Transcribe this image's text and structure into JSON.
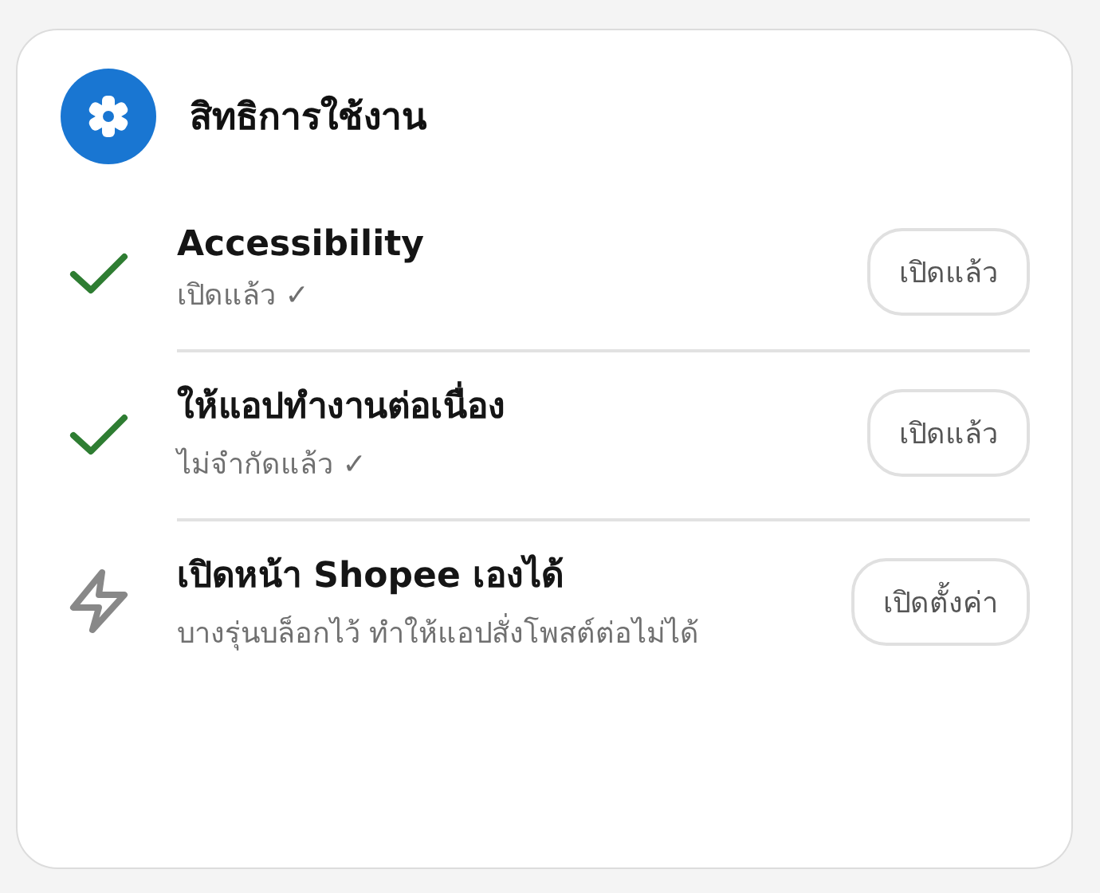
{
  "header": {
    "title": "สิทธิการใช้งาน"
  },
  "permissions": [
    {
      "kind": "done",
      "title": "Accessibility",
      "description": "เปิดแล้ว ✓",
      "button": "เปิดแล้ว"
    },
    {
      "kind": "done",
      "title": "ให้แอปทำงานต่อเนื่อง",
      "description": "ไม่จำกัดแล้ว ✓",
      "button": "เปิดแล้ว"
    },
    {
      "kind": "action",
      "title": "เปิดหน้า Shopee เองได้",
      "description": "บางรุ่นบล็อกไว้ ทำให้แอปสั่งโพสต์ต่อไม่ได้",
      "button": "เปิดตั้งค่า"
    }
  ]
}
